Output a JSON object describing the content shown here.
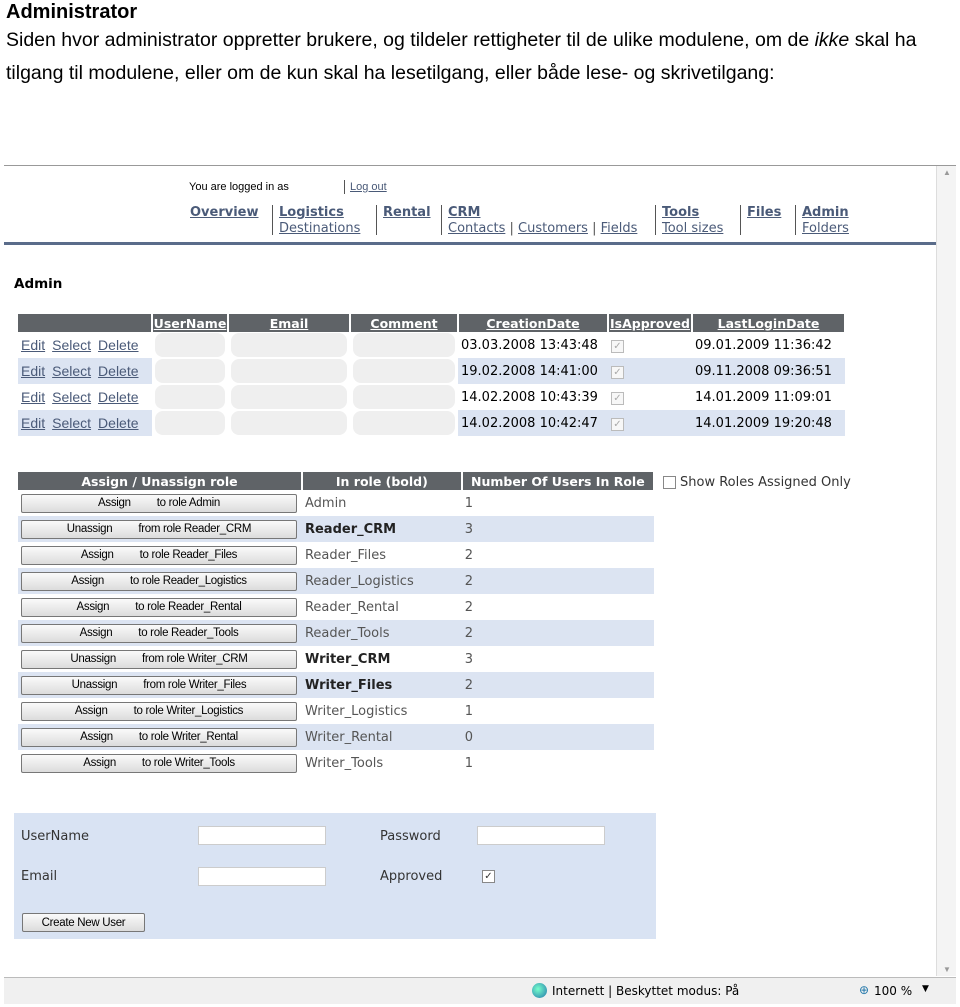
{
  "doc": {
    "title": "Administrator",
    "para_before": "Siden hvor administrator oppretter brukere, og tildeler rettigheter til de ulike modulene, om de ",
    "para_italic": "ikke",
    "para_after": " skal ha tilgang til modulene, eller om de kun skal ha lesetilgang, eller både lese- og skrivetilgang:"
  },
  "header": {
    "logged_in": "You are logged in as",
    "logout": "Log out",
    "nav": [
      {
        "label": "Overview",
        "subs": []
      },
      {
        "label": "Logistics",
        "subs": [
          "Destinations"
        ]
      },
      {
        "label": "Rental",
        "subs": []
      },
      {
        "label": "CRM",
        "subs": [
          "Contacts",
          "Customers",
          "Fields"
        ]
      },
      {
        "label": "Tools",
        "subs": [
          "Tool sizes"
        ]
      },
      {
        "label": "Files",
        "subs": []
      },
      {
        "label": "Admin",
        "subs": [
          "Folders"
        ]
      }
    ]
  },
  "page_title": "Admin",
  "users_table": {
    "columns": [
      "UserName",
      "Email",
      "Comment",
      "CreationDate",
      "IsApproved",
      "LastLoginDate"
    ],
    "actions": [
      "Edit",
      "Select",
      "Delete"
    ],
    "rows": [
      {
        "creation": "03.03.2008 13:43:48",
        "approved": true,
        "last_login": "09.01.2009 11:36:42"
      },
      {
        "creation": "19.02.2008 14:41:00",
        "approved": true,
        "last_login": "09.11.2008 09:36:51"
      },
      {
        "creation": "14.02.2008 10:43:39",
        "approved": true,
        "last_login": "14.01.2009 11:09:01"
      },
      {
        "creation": "14.02.2008 10:42:47",
        "approved": true,
        "last_login": "14.01.2009 19:20:48"
      }
    ]
  },
  "roles_table": {
    "columns": [
      "Assign / Unassign role",
      "In role (bold)",
      "Number Of Users In Role"
    ],
    "show_assigned_only": "Show Roles Assigned Only",
    "rows": [
      {
        "action": "Assign",
        "target": "to role Admin",
        "role": "Admin",
        "bold": false,
        "count": "1"
      },
      {
        "action": "Unassign",
        "target": "from role Reader_CRM",
        "role": "Reader_CRM",
        "bold": true,
        "count": "3"
      },
      {
        "action": "Assign",
        "target": "to role Reader_Files",
        "role": "Reader_Files",
        "bold": false,
        "count": "2"
      },
      {
        "action": "Assign",
        "target": "to role Reader_Logistics",
        "role": "Reader_Logistics",
        "bold": false,
        "count": "2"
      },
      {
        "action": "Assign",
        "target": "to role Reader_Rental",
        "role": "Reader_Rental",
        "bold": false,
        "count": "2"
      },
      {
        "action": "Assign",
        "target": "to role Reader_Tools",
        "role": "Reader_Tools",
        "bold": false,
        "count": "2"
      },
      {
        "action": "Unassign",
        "target": "from role Writer_CRM",
        "role": "Writer_CRM",
        "bold": true,
        "count": "3"
      },
      {
        "action": "Unassign",
        "target": "from role Writer_Files",
        "role": "Writer_Files",
        "bold": true,
        "count": "2"
      },
      {
        "action": "Assign",
        "target": "to role Writer_Logistics",
        "role": "Writer_Logistics",
        "bold": false,
        "count": "1"
      },
      {
        "action": "Assign",
        "target": "to role Writer_Rental",
        "role": "Writer_Rental",
        "bold": false,
        "count": "0"
      },
      {
        "action": "Assign",
        "target": "to role Writer_Tools",
        "role": "Writer_Tools",
        "bold": false,
        "count": "1"
      }
    ]
  },
  "form": {
    "username_label": "UserName",
    "password_label": "Password",
    "email_label": "Email",
    "approved_label": "Approved",
    "approved": true,
    "create_button": "Create New User"
  },
  "statusbar": {
    "zone": "Internett | Beskyttet modus: På",
    "zoom": "100 %"
  },
  "colors": {
    "header_bg": "#5f6367",
    "alt_row": "#dce4f2",
    "link": "#4a5a78",
    "nav_rule": "#5a6c8a"
  }
}
